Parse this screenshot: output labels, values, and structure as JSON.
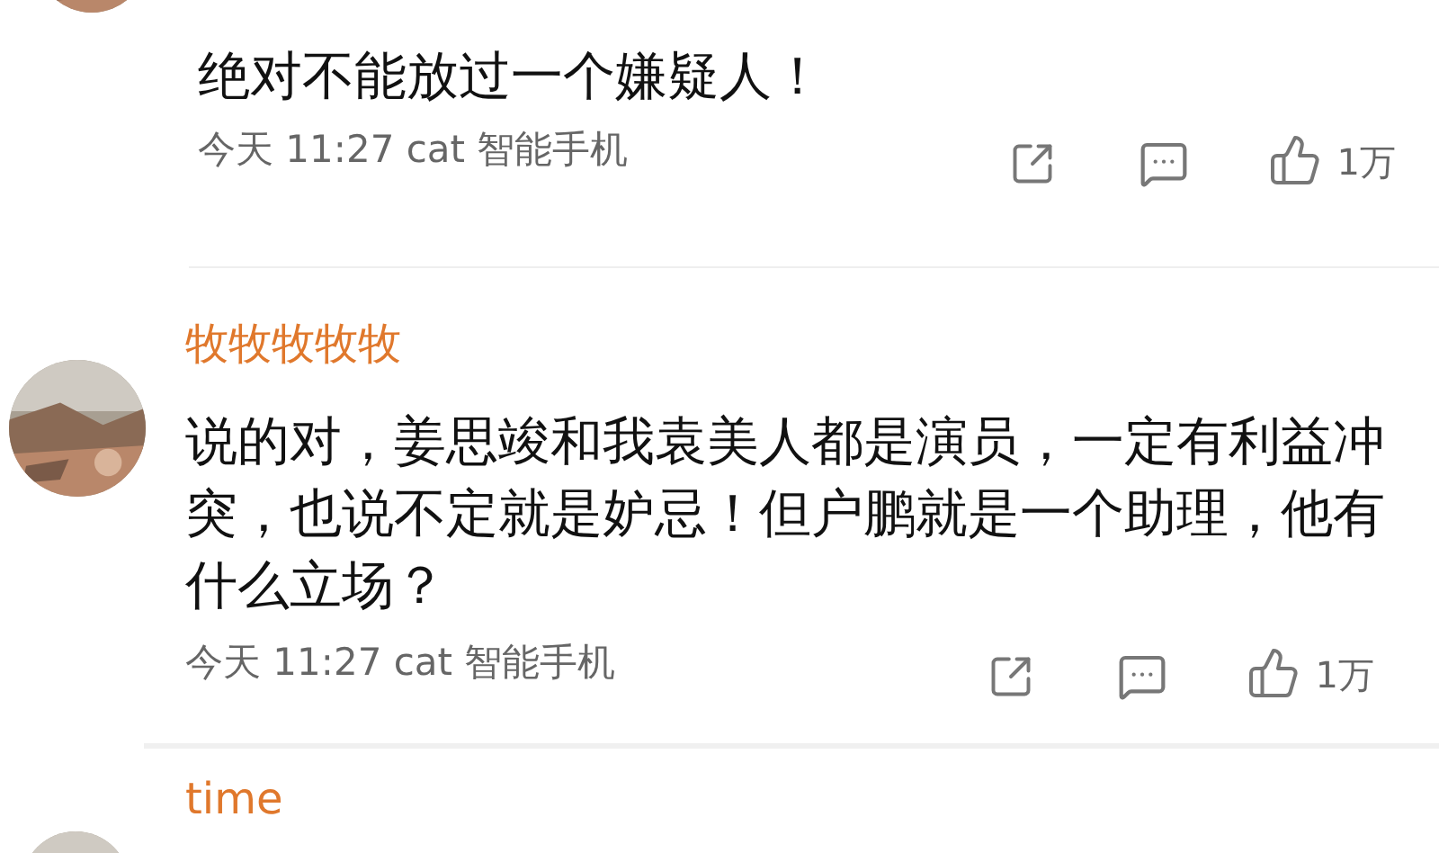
{
  "comments": [
    {
      "text": "绝对不能放过一个嫌疑人！",
      "time": "今天 11:27",
      "device": "cat 智能手机",
      "likes": "1万"
    },
    {
      "name": "牧牧牧牧牧",
      "text": "说的对，姜思竣和我袁美人都是演员，一定有利益冲突，也说不定就是妒忌！但户鹏就是一个助理，他有什么立场？",
      "time": "今天 11:27",
      "device": "cat 智能手机",
      "likes": "1万"
    },
    {
      "name": "time"
    }
  ]
}
